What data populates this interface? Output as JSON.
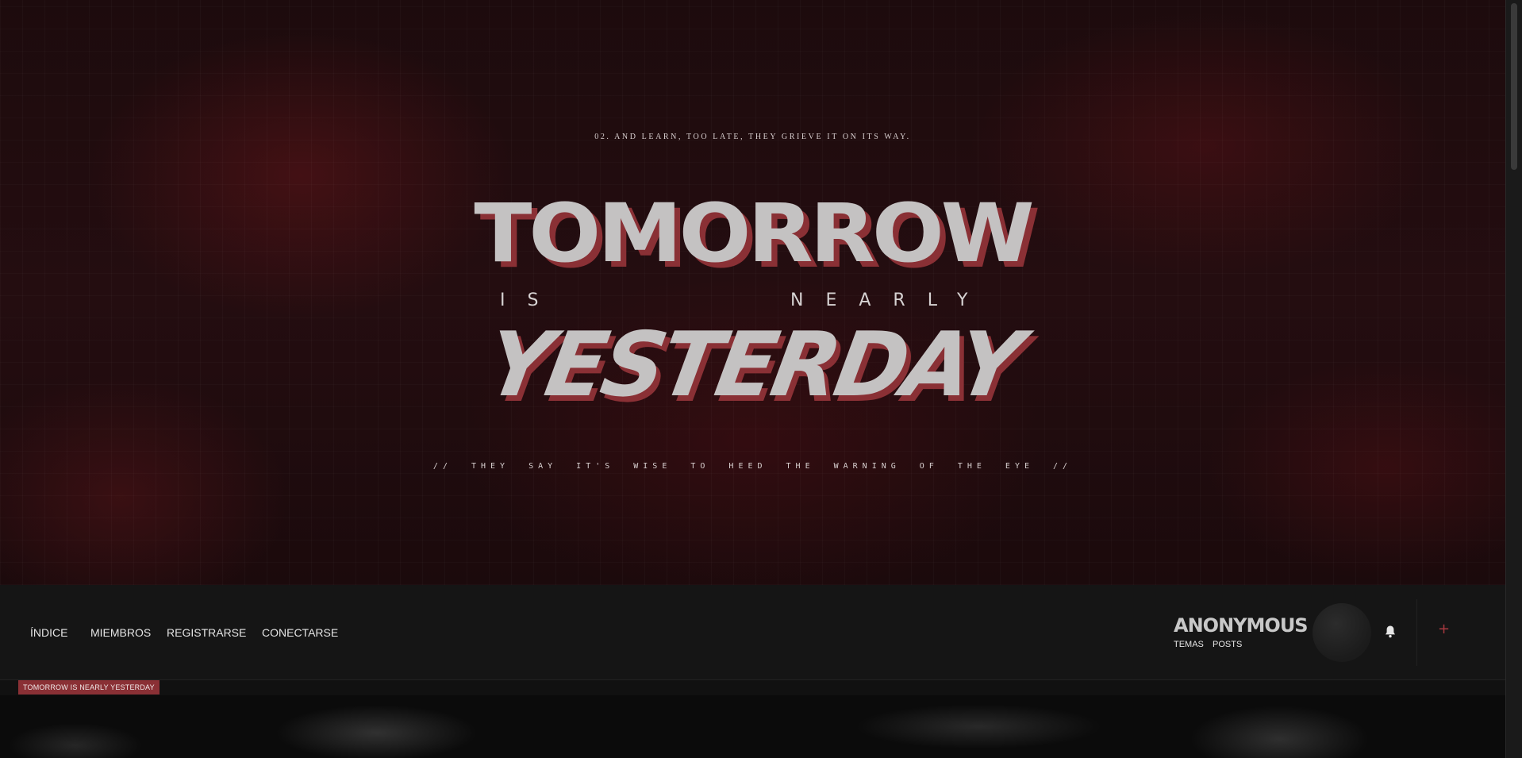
{
  "hero": {
    "kicker": "02. AND LEARN, TOO LATE, THEY GRIEVE IT ON ITS WAY.",
    "title_line1": "TOMORROW",
    "middle_left": "IS",
    "middle_right": "NEARLY",
    "title_line2": "YESTERDAY",
    "tagline": "// THEY SAY IT'S WISE TO HEED THE WARNING OF THE EYE //"
  },
  "nav": {
    "items": [
      {
        "label": "ÍNDICE"
      },
      {
        "label": "MIEMBROS"
      },
      {
        "label": "REGISTRARSE"
      },
      {
        "label": "CONECTARSE"
      }
    ]
  },
  "user": {
    "name": "ANONYMOUS",
    "links": [
      {
        "label": "TEMAS"
      },
      {
        "label": "POSTS"
      }
    ]
  },
  "actions": {
    "plus": "+"
  },
  "breadcrumb": {
    "label": "TOMORROW IS NEARLY YESTERDAY"
  },
  "colors": {
    "accent": "#8a3035",
    "hero_bg": "#240d10",
    "nav_bg": "#151515",
    "title_fg": "#c4c2c2"
  },
  "icons": {
    "notifications": "bell-icon",
    "create": "plus-icon"
  }
}
